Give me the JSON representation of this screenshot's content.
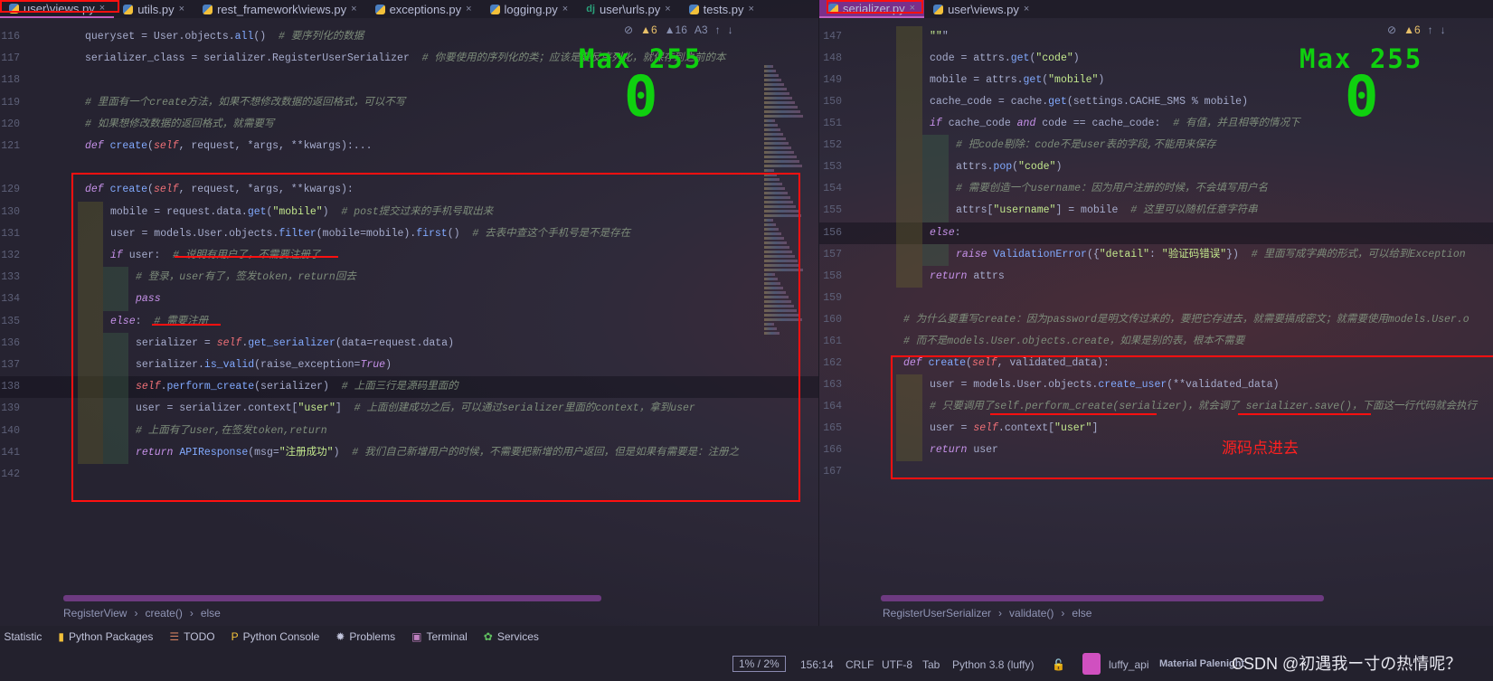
{
  "left": {
    "tabs": [
      {
        "label": "user\\views.py",
        "icon": "python-icon",
        "active": true
      },
      {
        "label": "utils.py",
        "icon": "python-icon"
      },
      {
        "label": "rest_framework\\views.py",
        "icon": "python-icon"
      },
      {
        "label": "exceptions.py",
        "icon": "python-icon"
      },
      {
        "label": "logging.py",
        "icon": "python-icon"
      },
      {
        "label": "user\\urls.py",
        "icon": "django-icon"
      },
      {
        "label": "tests.py",
        "icon": "python-icon"
      }
    ],
    "inspections": {
      "warnings": "6",
      "weak_warnings": "16",
      "typos": "3"
    },
    "lines": [
      {
        "n": "116",
        "i": 0,
        "t": "queryset = User.objects.all()  # 要序列化的数据"
      },
      {
        "n": "117",
        "i": 0,
        "t": "serializer_class = serializer.RegisterUserSerializer  # 你要使用的序列化的类；应该是要反序列化，就保存到之前的本"
      },
      {
        "n": "118",
        "i": 0,
        "t": ""
      },
      {
        "n": "119",
        "i": 0,
        "t": "# 里面有一个create方法，如果不想修改数据的返回格式，可以不写"
      },
      {
        "n": "120",
        "i": 0,
        "t": "# 如果想修改数据的返回格式，就需要写"
      },
      {
        "n": "121",
        "i": 0,
        "t": "def create(self, request, *args, **kwargs):..."
      },
      {
        "n": "",
        "i": 0,
        "t": ""
      },
      {
        "n": "129",
        "i": 0,
        "t": "def create(self, request, *args, **kwargs):"
      },
      {
        "n": "130",
        "i": 1,
        "t": "mobile = request.data.get(\"mobile\")  # post提交过来的手机号取出来"
      },
      {
        "n": "131",
        "i": 1,
        "t": "user = models.User.objects.filter(mobile=mobile).first()  # 去表中查这个手机号是不是存在"
      },
      {
        "n": "132",
        "i": 1,
        "t": "if user:  # 说明有用户了，不需要注册了"
      },
      {
        "n": "133",
        "i": 2,
        "t": "# 登录，user有了，签发token，return回去"
      },
      {
        "n": "134",
        "i": 2,
        "t": "pass"
      },
      {
        "n": "135",
        "i": 1,
        "t": "else:  # 需要注册"
      },
      {
        "n": "136",
        "i": 2,
        "t": "serializer = self.get_serializer(data=request.data)"
      },
      {
        "n": "137",
        "i": 2,
        "t": "serializer.is_valid(raise_exception=True)"
      },
      {
        "n": "138",
        "i": 2,
        "t": "self.perform_create(serializer)  # 上面三行是源码里面的"
      },
      {
        "n": "139",
        "i": 2,
        "t": "user = serializer.context[\"user\"]  # 上面创建成功之后，可以通过serializer里面的context，拿到user"
      },
      {
        "n": "140",
        "i": 2,
        "t": "# 上面有了user,在签发token,return"
      },
      {
        "n": "141",
        "i": 2,
        "t": "return APIResponse(msg=\"注册成功\")  # 我们自己新增用户的时候，不需要把新增的用户返回，但是如果有需要是：注册之"
      },
      {
        "n": "142",
        "i": 0,
        "t": ""
      }
    ],
    "current_line": "138",
    "breadcrumb": [
      "RegisterView",
      "create()",
      "else"
    ]
  },
  "right": {
    "tabs": [
      {
        "label": "serializer.py",
        "icon": "python-icon",
        "active": true
      },
      {
        "label": "user\\views.py",
        "icon": "python-icon"
      }
    ],
    "inspections": {
      "warnings": "6"
    },
    "lines": [
      {
        "n": "147",
        "i": 1,
        "t": "\"\"\""
      },
      {
        "n": "148",
        "i": 1,
        "t": "code = attrs.get(\"code\")"
      },
      {
        "n": "149",
        "i": 1,
        "t": "mobile = attrs.get(\"mobile\")"
      },
      {
        "n": "150",
        "i": 1,
        "t": "cache_code = cache.get(settings.CACHE_SMS % mobile)"
      },
      {
        "n": "151",
        "i": 1,
        "t": "if cache_code and code == cache_code:  # 有值，并且相等的情况下"
      },
      {
        "n": "152",
        "i": 2,
        "t": "# 把code剔除：code不是user表的字段,不能用来保存"
      },
      {
        "n": "153",
        "i": 2,
        "t": "attrs.pop(\"code\")"
      },
      {
        "n": "154",
        "i": 2,
        "t": "# 需要创造一个username：因为用户注册的时候，不会填写用户名"
      },
      {
        "n": "155",
        "i": 2,
        "t": "attrs[\"username\"] = mobile  # 这里可以随机任意字符串"
      },
      {
        "n": "156",
        "i": 1,
        "t": "else:"
      },
      {
        "n": "157",
        "i": 2,
        "t": "raise ValidationError({\"detail\": \"验证码错误\"})  # 里面写成字典的形式，可以给到Exception"
      },
      {
        "n": "158",
        "i": 1,
        "t": "return attrs"
      },
      {
        "n": "159",
        "i": 0,
        "t": ""
      },
      {
        "n": "160",
        "i": 0,
        "t": "# 为什么要重写create：因为password是明文传过来的，要把它存进去，就需要搞成密文；就需要使用models.User.o"
      },
      {
        "n": "161",
        "i": 0,
        "t": "# 而不是models.User.objects.create，如果是别的表，根本不需要"
      },
      {
        "n": "162",
        "i": 0,
        "t": "def create(self, validated_data):"
      },
      {
        "n": "163",
        "i": 1,
        "t": "user = models.User.objects.create_user(**validated_data)"
      },
      {
        "n": "164",
        "i": 1,
        "t": "# 只要调用了self.perform_create(serializer)，就会调了 serializer.save()，下面这一行代码就会执行"
      },
      {
        "n": "165",
        "i": 1,
        "t": "user = self.context[\"user\"]"
      },
      {
        "n": "166",
        "i": 1,
        "t": "return user"
      },
      {
        "n": "167",
        "i": 0,
        "t": ""
      }
    ],
    "current_line": "156",
    "breadcrumb": [
      "RegisterUserSerializer",
      "validate()",
      "else"
    ]
  },
  "overlay": {
    "max_label": "Max 255",
    "value": "0"
  },
  "annotation": "源码点进去",
  "toolwindows": [
    {
      "label": "Statistic",
      "icon": "chart-icon"
    },
    {
      "label": "Python Packages",
      "icon": "package-icon"
    },
    {
      "label": "TODO",
      "icon": "todo-icon"
    },
    {
      "label": "Python Console",
      "icon": "python-console-icon"
    },
    {
      "label": "Problems",
      "icon": "problems-icon"
    },
    {
      "label": "Terminal",
      "icon": "terminal-icon"
    },
    {
      "label": "Services",
      "icon": "services-icon"
    }
  ],
  "status": {
    "memory": "1% / 2%",
    "position": "156:14",
    "line_sep": "CRLF",
    "encoding": "UTF-8",
    "indent": "Tab",
    "interpreter": "Python 3.8 (luffy)",
    "project": "luffy_api",
    "theme": "Material Palenight"
  },
  "watermark": "CSDN @初遇我ー寸の热情呢？",
  "colors": {
    "annotation_red": "#ff1010",
    "overlay_green": "#0fd00f",
    "active_tab_right": "#7a2f8a"
  }
}
